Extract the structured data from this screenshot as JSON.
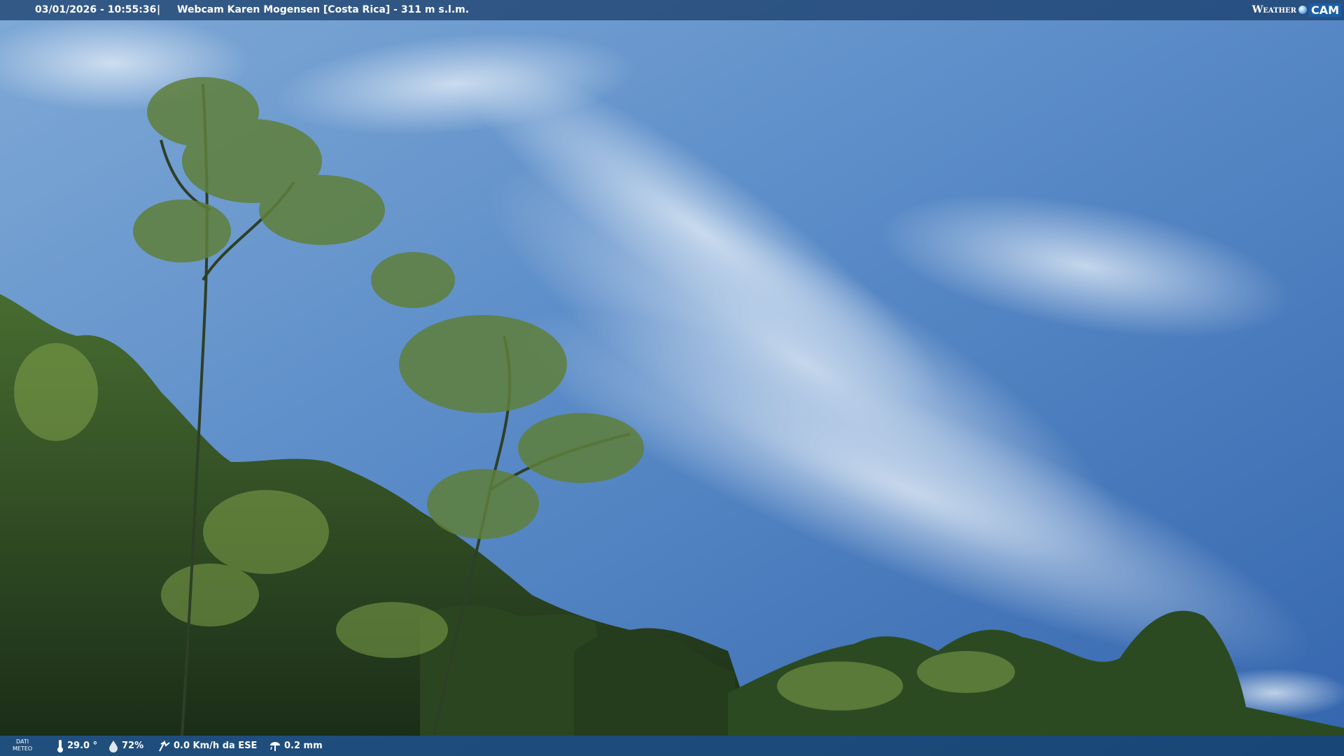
{
  "header": {
    "datetime": "03/01/2026 - 10:55:36",
    "separator": "|",
    "title": "Webcam Karen Mogensen [Costa Rica]  - 311 m s.l.m.",
    "logo_text_weather": "Weather",
    "logo_text_cam": "CAM"
  },
  "footer": {
    "dati_line1": "DATI",
    "dati_line2": "METEO",
    "temperature": "29.0 °",
    "humidity": "72%",
    "wind": "0.0 Km/h da ESE",
    "rain": "0.2 mm"
  },
  "colors": {
    "sky_top": "#3a6fb5",
    "sky_clouds": "#d5e5f2",
    "foliage_dark": "#1f3a1c",
    "foliage_light": "#8fae58"
  },
  "icons": {
    "temperature": "thermometer-icon",
    "humidity": "drop-icon",
    "wind": "wind-icon",
    "rain": "rain-gauge-icon"
  }
}
